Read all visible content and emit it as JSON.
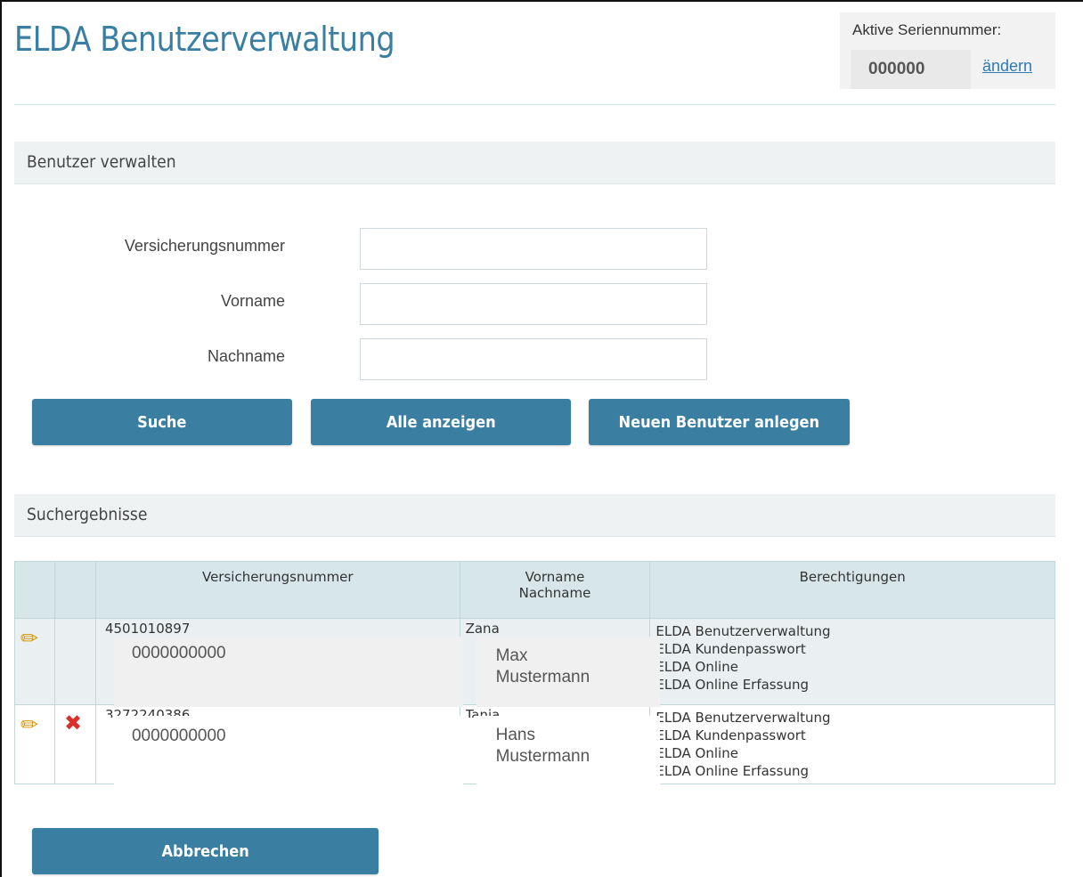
{
  "header": {
    "title": "ELDA Benutzerverwaltung",
    "serial_label": "Aktive Seriennummer:",
    "serial_value": "000000",
    "serial_change": "ändern"
  },
  "manage_section": {
    "title": "Benutzer verwalten"
  },
  "form": {
    "fields": [
      {
        "label": "Versicherungsnummer",
        "value": ""
      },
      {
        "label": "Vorname",
        "value": ""
      },
      {
        "label": "Nachname",
        "value": ""
      }
    ],
    "buttons": {
      "search": "Suche",
      "show_all": "Alle anzeigen",
      "new_user": "Neuen Benutzer anlegen"
    }
  },
  "results_section": {
    "title": "Suchergebnisse"
  },
  "table": {
    "headers": {
      "insurance_number": "Versicherungsnummer",
      "name_line1": "Vorname",
      "name_line2": "Nachname",
      "permissions": "Berechtigungen"
    },
    "rows": [
      {
        "insurance_number_behind": "4501010897",
        "insurance_number": "0000000000",
        "first_name_behind": "Zana",
        "first_name": "Max",
        "last_name": "Mustermann",
        "permissions": [
          "ELDA Benutzerverwaltung",
          "ELDA Kundenpasswort",
          "ELDA Online",
          "ELDA Online Erfassung"
        ],
        "deletable": false
      },
      {
        "insurance_number_behind": "3272240386",
        "insurance_number": "0000000000",
        "first_name_behind": "Tanja",
        "first_name": "Hans",
        "last_name": "Mustermann",
        "permissions": [
          "ELDA Benutzerverwaltung",
          "ELDA Kundenpasswort",
          "ELDA Online",
          "ELDA Online Erfassung"
        ],
        "deletable": true
      }
    ]
  },
  "footer": {
    "cancel": "Abbrechen"
  },
  "icons": {
    "edit": "pencil-icon",
    "delete": "delete-x-icon"
  },
  "colors": {
    "accent": "#3a7ea1",
    "delete": "#d9302a",
    "edit": "#d49a14"
  }
}
